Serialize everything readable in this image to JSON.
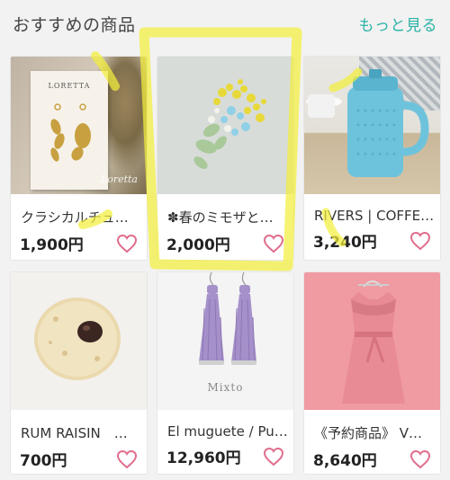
{
  "header": {
    "title": "おすすめの商品",
    "more_link": "もっと見る"
  },
  "products": [
    {
      "name": "クラシカルチュ…",
      "price": "1,900円",
      "thumb_text": "LORETTA",
      "thumb_script": "Loretta"
    },
    {
      "name": "✽春のミモザと…",
      "price": "2,000円"
    },
    {
      "name": "RIVERS | COFFE…",
      "price": "3,240円"
    },
    {
      "name": "RUM RAISIN　…",
      "price": "700円"
    },
    {
      "name": "El muguete / Pu…",
      "price": "12,960円",
      "thumb_text": "Mixto"
    },
    {
      "name": "《予約商品》 V…",
      "price": "8,640円"
    }
  ],
  "colors": {
    "accent": "#2bb3a6",
    "heart": "#e06d8c",
    "highlighter": "#f2ee3c"
  },
  "icons": {
    "favorite": "heart-outline-icon"
  }
}
